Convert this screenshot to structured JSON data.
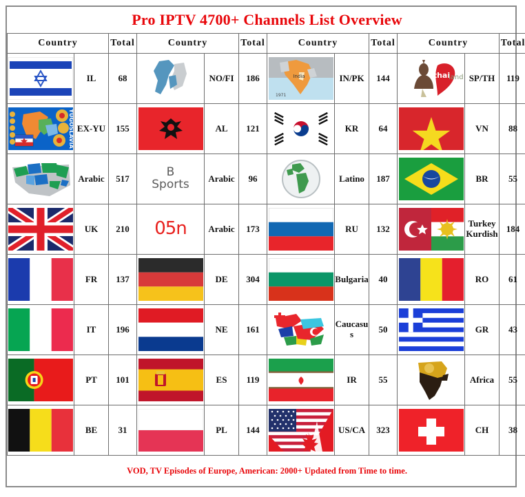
{
  "title": "Pro IPTV 4700+ Channels List Overview",
  "footer": "VOD, TV Episodes of Europe, American: 2000+ Updated from Time to time.",
  "colors": {
    "accent_red": "#e8060a",
    "border": "#6d6d6d",
    "frame": "#8a8a8a",
    "text": "#111111"
  },
  "headers": {
    "country": "Country",
    "total": "Total"
  },
  "column_groups": [
    {
      "country_header": "Country",
      "total_header": "Total"
    },
    {
      "country_header": "Country",
      "total_header": "Total"
    },
    {
      "country_header": "Country",
      "total_header": "Total"
    },
    {
      "country_header": "Country",
      "total_header": "Total"
    }
  ],
  "rows": [
    [
      {
        "icon": "israel-flag",
        "label": "IL",
        "total": "68"
      },
      {
        "icon": "norway-finland-map",
        "label": "NO/FI",
        "total": "186"
      },
      {
        "icon": "india-pakistan-map",
        "label": "IN/PK",
        "total": "144"
      },
      {
        "icon": "thailand-logo",
        "label": "SP/TH",
        "total": "119"
      }
    ],
    [
      {
        "icon": "yugoslavia-map",
        "label": "EX-YU",
        "total": "155"
      },
      {
        "icon": "albania-flag",
        "label": "AL",
        "total": "121"
      },
      {
        "icon": "south-korea-flag",
        "label": "KR",
        "total": "64"
      },
      {
        "icon": "vietnam-flag",
        "label": "VN",
        "total": "88"
      }
    ],
    [
      {
        "icon": "arab-world-map",
        "label": "Arabic",
        "total": "517"
      },
      {
        "icon": "b-sports-logo",
        "label": "Arabic",
        "total": "96",
        "logo_text": "B Sports"
      },
      {
        "icon": "latin-america-globe",
        "label": "Latino",
        "total": "187"
      },
      {
        "icon": "brazil-flag",
        "label": "BR",
        "total": "55"
      }
    ],
    [
      {
        "icon": "uk-flag",
        "label": "UK",
        "total": "210"
      },
      {
        "icon": "o5n-logo",
        "label": "Arabic",
        "total": "173",
        "logo_text": "05n"
      },
      {
        "icon": "russia-flag",
        "label": "RU",
        "total": "132"
      },
      {
        "icon": "turkey-kurdish-flag",
        "label": "Turkey Kurdish",
        "total": "184"
      }
    ],
    [
      {
        "icon": "france-flag",
        "label": "FR",
        "total": "137"
      },
      {
        "icon": "germany-flag",
        "label": "DE",
        "total": "304"
      },
      {
        "icon": "bulgaria-flag",
        "label": "Bulgaria",
        "total": "40"
      },
      {
        "icon": "romania-flag",
        "label": "RO",
        "total": "61"
      }
    ],
    [
      {
        "icon": "italy-flag",
        "label": "IT",
        "total": "196"
      },
      {
        "icon": "netherlands-flag",
        "label": "NE",
        "total": "161"
      },
      {
        "icon": "caucasus-map",
        "label": "Caucasus",
        "total": "50"
      },
      {
        "icon": "greece-flag",
        "label": "GR",
        "total": "43"
      }
    ],
    [
      {
        "icon": "portugal-flag",
        "label": "PT",
        "total": "101"
      },
      {
        "icon": "spain-flag",
        "label": "ES",
        "total": "119"
      },
      {
        "icon": "iran-flag",
        "label": "IR",
        "total": "55"
      },
      {
        "icon": "africa-map",
        "label": "Africa",
        "total": "55"
      }
    ],
    [
      {
        "icon": "belgium-flag",
        "label": "BE",
        "total": "31"
      },
      {
        "icon": "poland-flag",
        "label": "PL",
        "total": "144"
      },
      {
        "icon": "usa-canada-flag",
        "label": "US/CA",
        "total": "323"
      },
      {
        "icon": "switzerland-flag",
        "label": "CH",
        "total": "38"
      }
    ]
  ]
}
